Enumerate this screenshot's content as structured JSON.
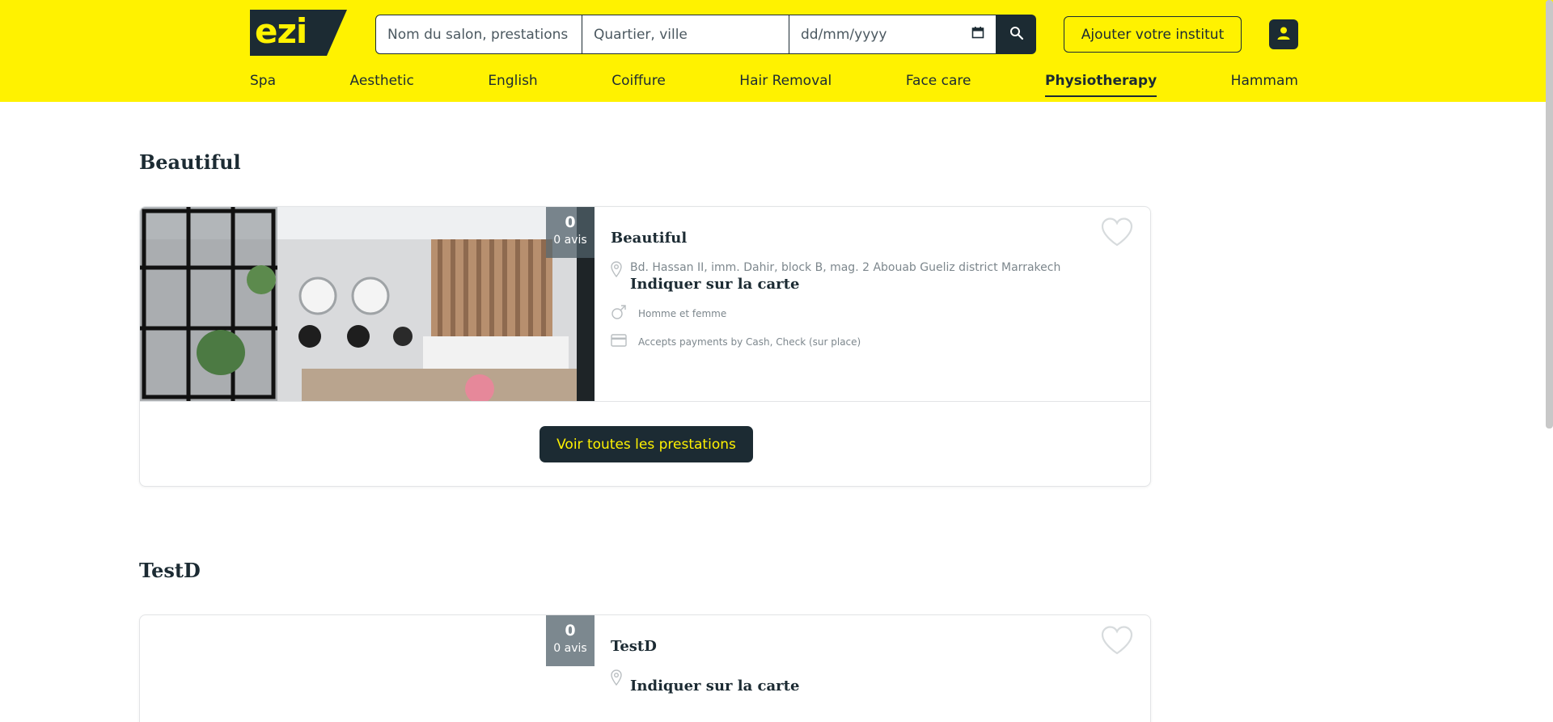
{
  "header": {
    "logo_text": "ezi",
    "search": {
      "name_placeholder": "Nom du salon, prestations",
      "location_placeholder": "Quartier, ville",
      "date_placeholder": "dd/mm/yyyy"
    },
    "add_institute_label": "Ajouter votre institut",
    "nav": [
      {
        "label": "Spa",
        "active": false
      },
      {
        "label": "Aesthetic",
        "active": false
      },
      {
        "label": "English",
        "active": false
      },
      {
        "label": "Coiffure",
        "active": false
      },
      {
        "label": "Hair Removal",
        "active": false
      },
      {
        "label": "Face care",
        "active": false
      },
      {
        "label": "Physiotherapy",
        "active": true
      },
      {
        "label": "Hammam",
        "active": false
      }
    ]
  },
  "listings": [
    {
      "section_title": "Beautiful",
      "name": "Beautiful",
      "rating": "0",
      "reviews": "0 avis",
      "address": "Bd. Hassan II, imm. Dahir, block B, mag. 2 Abouab Gueliz district Marrakech",
      "map_link": "Indiquer sur la carte",
      "gender": "Homme et femme",
      "payment": "Accepts payments by Cash, Check (sur place)",
      "cta": "Voir toutes les prestations"
    },
    {
      "section_title": "TestD",
      "name": "TestD",
      "rating": "0",
      "reviews": "0 avis",
      "address": "",
      "map_link": "Indiquer sur la carte"
    }
  ],
  "colors": {
    "brand_yellow": "#fff200",
    "dark": "#1c2b33"
  }
}
